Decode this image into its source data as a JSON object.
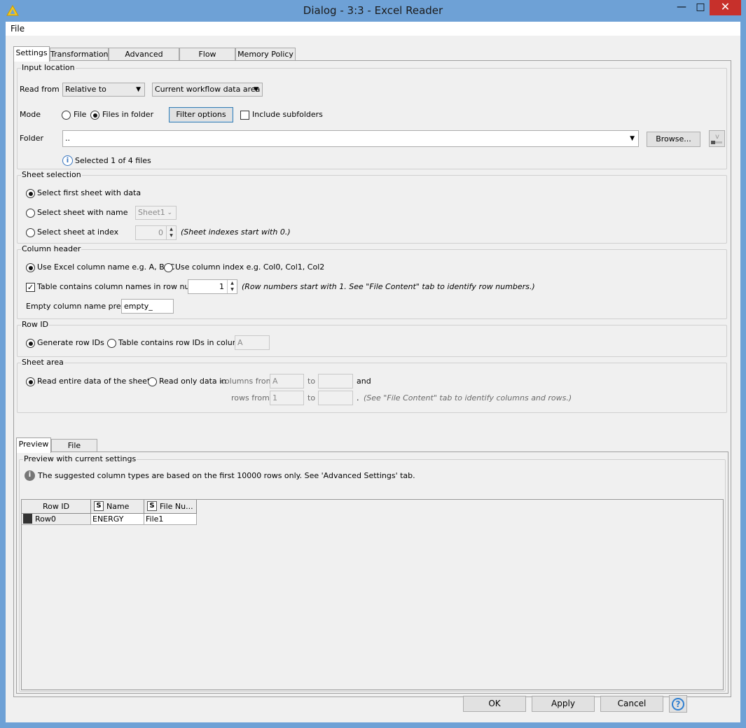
{
  "window": {
    "title": "Dialog - 3:3 - Excel Reader",
    "min_glyph": "—",
    "max_glyph": "□",
    "close_glyph": "✕"
  },
  "menubar": {
    "file": "File"
  },
  "tabs": [
    "Settings",
    "Transformation",
    "Advanced Settings",
    "Flow Variables",
    "Memory Policy"
  ],
  "input_location": {
    "title": "Input location",
    "read_from_label": "Read from",
    "read_from_value": "Relative to",
    "relative_value": "Current workflow data area",
    "mode_label": "Mode",
    "mode_file": "File",
    "mode_files_in_folder": "Files in folder",
    "filter_options": "Filter options",
    "include_subfolders": "Include subfolders",
    "folder_label": "Folder",
    "folder_value": "..",
    "browse": "Browse...",
    "selected_info": "Selected 1 of 4 files"
  },
  "sheet_selection": {
    "title": "Sheet selection",
    "first_sheet": "Select first sheet with data",
    "sheet_with_name": "Select sheet with name",
    "sheet_name_value": "Sheet1",
    "sheet_at_index": "Select sheet at index",
    "index_value": "0",
    "index_hint": "(Sheet indexes start with 0.)"
  },
  "column_header": {
    "title": "Column header",
    "use_excel_name": "Use Excel column name e.g. A, B, C",
    "use_index": "Use column index e.g. Col0, Col1, Col2",
    "contains_names": "Table contains column names in row number",
    "row_number": "1",
    "row_hint": "(Row numbers start with 1. See \"File Content\" tab to identify row numbers.)",
    "empty_prefix_label": "Empty column name prefix:",
    "empty_prefix_value": "empty_"
  },
  "row_id": {
    "title": "Row ID",
    "generate": "Generate row IDs",
    "contains_ids": "Table contains row IDs in column",
    "column_value": "A"
  },
  "sheet_area": {
    "title": "Sheet area",
    "read_entire": "Read entire data of the sheet",
    "read_only": "Read only data in",
    "columns_from": "columns from",
    "col_from_value": "A",
    "to": "to",
    "and": "and",
    "rows_from": "rows from",
    "row_from_value": "1",
    "dot": ".",
    "hint": "(See \"File Content\" tab to identify columns and rows.)"
  },
  "preview": {
    "tabs": [
      "Preview",
      "File Content"
    ],
    "title": "Preview with current settings",
    "info": "The suggested column types are based on the first 10000 rows only. See 'Advanced Settings' tab.",
    "columns": [
      {
        "name": "Row ID",
        "type": ""
      },
      {
        "name": "Name",
        "type": "S"
      },
      {
        "name": "File Nu...",
        "type": "S"
      }
    ],
    "rows": [
      [
        "Row0",
        "ENERGY",
        "File1"
      ]
    ]
  },
  "footer": {
    "ok": "OK",
    "apply": "Apply",
    "cancel": "Cancel",
    "help": "?"
  }
}
